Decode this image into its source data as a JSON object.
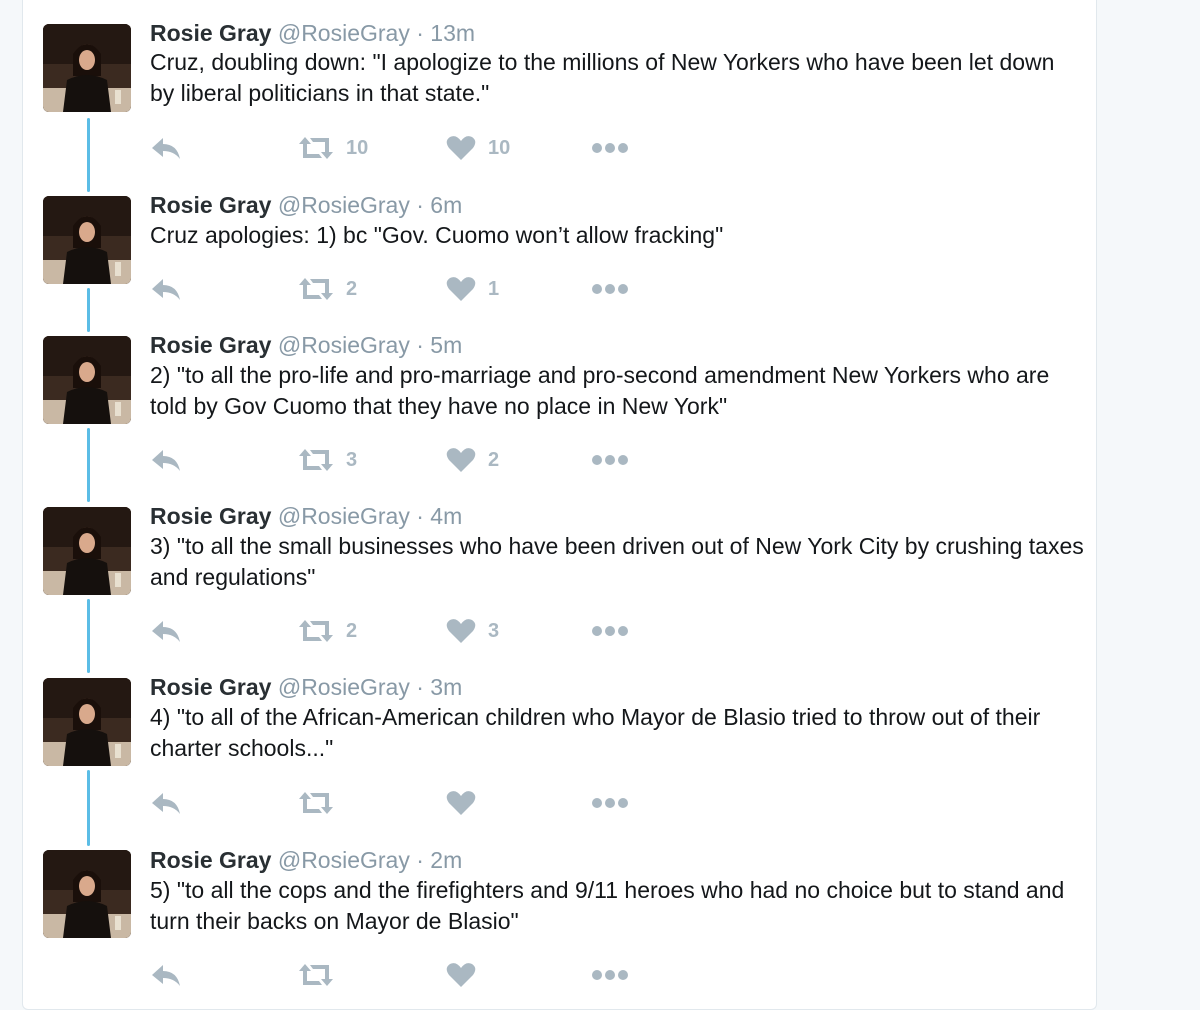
{
  "tweets": [
    {
      "name": "Rosie Gray",
      "handle": "@RosieGray",
      "time": "13m",
      "text": "Cruz, doubling down: \"I apologize to the millions of New Yorkers who have been let down by liberal politicians in that state.\"",
      "retweets": "10",
      "likes": "10"
    },
    {
      "name": "Rosie Gray",
      "handle": "@RosieGray",
      "time": "6m",
      "text": "Cruz apologies: 1) bc \"Gov. Cuomo won’t allow fracking\"",
      "retweets": "2",
      "likes": "1"
    },
    {
      "name": "Rosie Gray",
      "handle": "@RosieGray",
      "time": "5m",
      "text": "2) \"to all the pro-life and pro-marriage and pro-second amendment New Yorkers who are told by Gov Cuomo that they have no place in New York\"",
      "retweets": "3",
      "likes": "2"
    },
    {
      "name": "Rosie Gray",
      "handle": "@RosieGray",
      "time": "4m",
      "text": "3) \"to all the small businesses who have been driven out of New York City by crushing taxes and regulations\"",
      "retweets": "2",
      "likes": "3"
    },
    {
      "name": "Rosie Gray",
      "handle": "@RosieGray",
      "time": "3m",
      "text": "4) \"to all of the African-American children who Mayor de Blasio tried to throw out of their charter schools...\"",
      "retweets": "",
      "likes": ""
    },
    {
      "name": "Rosie Gray",
      "handle": "@RosieGray",
      "time": "2m",
      "text": "5) \"to all the cops and the firefighters and 9/11 heroes who had no choice but to stand and turn their backs on Mayor de Blasio\"",
      "retweets": "",
      "likes": ""
    }
  ],
  "separator": "·",
  "icons": {
    "reply": "reply-icon",
    "retweet": "retweet-icon",
    "like": "heart-icon",
    "more": "more-icon"
  },
  "colors": {
    "thread_line": "#5bbde6",
    "muted": "#8899a6",
    "icon": "#aab8c2"
  }
}
